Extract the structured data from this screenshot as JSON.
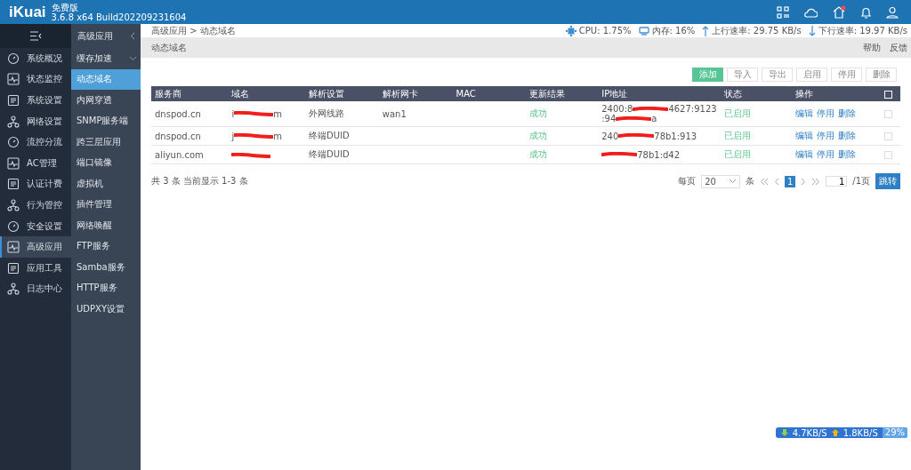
{
  "header": {
    "logo": "iKuai",
    "edition": "免费版",
    "version": "3.6.8 x64 Build202209231604",
    "notification_dot": true
  },
  "nav": {
    "items": [
      {
        "label": "系统概况",
        "selected": false
      },
      {
        "label": "状态监控",
        "selected": false
      },
      {
        "label": "系统设置",
        "selected": false
      },
      {
        "label": "网络设置",
        "selected": false
      },
      {
        "label": "流控分流",
        "selected": false
      },
      {
        "label": "AC管理",
        "selected": false
      },
      {
        "label": "认证计费",
        "selected": false
      },
      {
        "label": "行为管控",
        "selected": false
      },
      {
        "label": "安全设置",
        "selected": false
      },
      {
        "label": "高级应用",
        "selected": true
      },
      {
        "label": "应用工具",
        "selected": false
      },
      {
        "label": "日志中心",
        "selected": false
      }
    ]
  },
  "subnav": {
    "title": "高级应用",
    "items": [
      {
        "label": "缓存加速",
        "selected": false,
        "expandable": true
      },
      {
        "label": "动态域名",
        "selected": true,
        "expandable": false
      },
      {
        "label": "内网穿透",
        "selected": false,
        "expandable": false
      },
      {
        "label": "SNMP服务端",
        "selected": false,
        "expandable": false
      },
      {
        "label": "跨三层应用",
        "selected": false,
        "expandable": false
      },
      {
        "label": "端口镜像",
        "selected": false,
        "expandable": false
      },
      {
        "label": "虚拟机",
        "selected": false,
        "expandable": false
      },
      {
        "label": "插件管理",
        "selected": false,
        "expandable": false
      },
      {
        "label": "网络唤醒",
        "selected": false,
        "expandable": false
      },
      {
        "label": "FTP服务",
        "selected": false,
        "expandable": false
      },
      {
        "label": "Samba服务",
        "selected": false,
        "expandable": false
      },
      {
        "label": "HTTP服务",
        "selected": false,
        "expandable": false
      },
      {
        "label": "UDPXY设置",
        "selected": false,
        "expandable": false
      }
    ]
  },
  "breadcrumb": "高级应用 > 动态域名",
  "stats": [
    {
      "kind": "cpu",
      "text": "CPU: 1.75%"
    },
    {
      "kind": "memory",
      "text": "内存: 16%"
    },
    {
      "kind": "up",
      "text": "上行速率: 29.75 KB/s"
    },
    {
      "kind": "down",
      "text": "下行速率: 19.97 KB/s"
    }
  ],
  "page_title": "动态域名",
  "page_links": [
    "帮助",
    "反馈"
  ],
  "toolbar": [
    {
      "label": "添加",
      "primary": true
    },
    {
      "label": "导入",
      "primary": false
    },
    {
      "label": "导出",
      "primary": false
    },
    {
      "label": "启用",
      "primary": false
    },
    {
      "label": "停用",
      "primary": false
    },
    {
      "label": "删除",
      "primary": false
    }
  ],
  "table": {
    "columns": [
      "服务商",
      "域名",
      "解析设置",
      "解析网卡",
      "MAC",
      "更新结果",
      "IP地址",
      "状态",
      "操作"
    ],
    "select_all_checked": false,
    "rows": [
      {
        "provider": "dnspod.cn",
        "domain": [
          {
            "kind": "text",
            "text": "i"
          },
          {
            "kind": "redacted"
          },
          {
            "kind": "text",
            "text": "m"
          }
        ],
        "setting": "外网线路",
        "nic": "wan1",
        "mac": "",
        "result": "成功",
        "ip": [
          [
            {
              "kind": "text",
              "text": "2400:8"
            },
            {
              "kind": "redacted"
            },
            {
              "kind": "text",
              "text": "4627:9123"
            }
          ],
          [
            {
              "kind": "text",
              "text": ":94"
            },
            {
              "kind": "redacted"
            },
            {
              "kind": "text",
              "text": "a"
            }
          ]
        ],
        "status": "已启用",
        "actions": [
          "编辑",
          "停用",
          "删除"
        ],
        "checked": false
      },
      {
        "provider": "dnspod.cn",
        "domain": [
          {
            "kind": "text",
            "text": "j"
          },
          {
            "kind": "redacted"
          },
          {
            "kind": "text",
            "text": "m"
          }
        ],
        "setting": "终端DUID",
        "nic": "",
        "mac": "",
        "result": "成功",
        "ip": [
          [
            {
              "kind": "text",
              "text": "240"
            },
            {
              "kind": "redacted"
            },
            {
              "kind": "text",
              "text": "78b1:913"
            }
          ]
        ],
        "status": "已启用",
        "actions": [
          "编辑",
          "停用",
          "删除"
        ],
        "checked": false
      },
      {
        "provider": "aliyun.com",
        "domain": [
          {
            "kind": "redacted"
          }
        ],
        "setting": "终端DUID",
        "nic": "",
        "mac": "",
        "result": "成功",
        "ip": [
          [
            {
              "kind": "redacted"
            },
            {
              "kind": "text",
              "text": "78b1:d42"
            }
          ]
        ],
        "status": "已启用",
        "actions": [
          "编辑",
          "停用",
          "删除"
        ],
        "checked": false
      }
    ]
  },
  "summary": "共 3 条 当前显示 1-3 条",
  "pagination": {
    "per_page_label": "每页",
    "per_page": "20",
    "unit": "条",
    "pages": [
      {
        "label": "1",
        "selected": true
      }
    ],
    "page_input": "1",
    "total": "/1页",
    "go": "跳转"
  },
  "traffic_widget": {
    "down": "4.7KB/S",
    "up": "1.8KB/S",
    "percent": "29%"
  }
}
